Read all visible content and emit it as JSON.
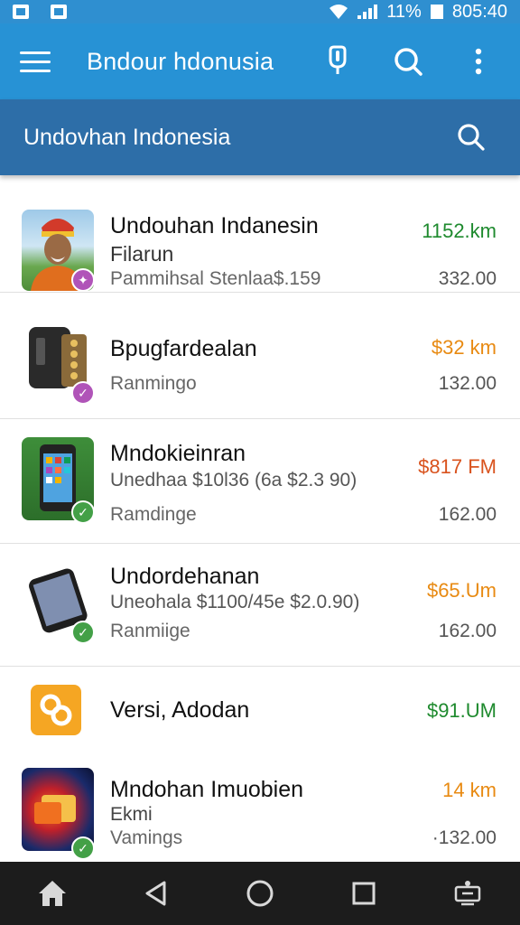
{
  "status_bar": {
    "battery": "11%",
    "time": "805:40"
  },
  "app_bar": {
    "title": "Bndour  hdonusia"
  },
  "search_header": {
    "text": "Undovhan Indonesia"
  },
  "items": [
    {
      "title": "Undouhan Indanesin",
      "line2": "Filarun",
      "line3": "Pammihsal Stenlaa$.159",
      "price": "1152.km",
      "price_color": "#1e8a2e",
      "sub_price": "332.00",
      "badge_color": "#b054b8"
    },
    {
      "title": "Bpugfardealan",
      "line2": "",
      "line3": "Ranmingo",
      "price": "$32 km",
      "price_color": "#e88a12",
      "sub_price": "132.00",
      "badge_color": "#b054b8"
    },
    {
      "title": "Mndokieinran",
      "line2": "Unedhaa $10l36 (6a $2.3 90)",
      "line3": "Ramdinge",
      "price": "$817 FM",
      "price_color": "#d9531e",
      "sub_price": "162.00",
      "badge_color": "#43a047"
    },
    {
      "title": "Undordehanan",
      "line2": "Uneohala $1100/45e $2.0.90)",
      "line3": "Ranmiige",
      "price": "$65.Um",
      "price_color": "#e88a12",
      "sub_price": "162.00",
      "badge_color": "#43a047"
    },
    {
      "title": "Versi, Adodan",
      "line2": "",
      "line3": "",
      "price": "$91.UM",
      "price_color": "#1e8a2e",
      "sub_price": "",
      "badge_color": ""
    },
    {
      "title": "Mndohan Imuobien",
      "line2": "Ekmi",
      "line3": "Vamings",
      "price": "14 km",
      "price_color": "#e88a12",
      "sub_price": "·132.00",
      "badge_color": "#43a047"
    }
  ],
  "icons": {
    "menu": "menu-icon",
    "mic": "microphone-icon",
    "search": "search-icon",
    "more": "more-vert-icon",
    "home": "home-icon",
    "back": "back-icon",
    "circle": "home-circle-icon",
    "recents": "recents-icon",
    "extra": "accessibility-icon"
  }
}
